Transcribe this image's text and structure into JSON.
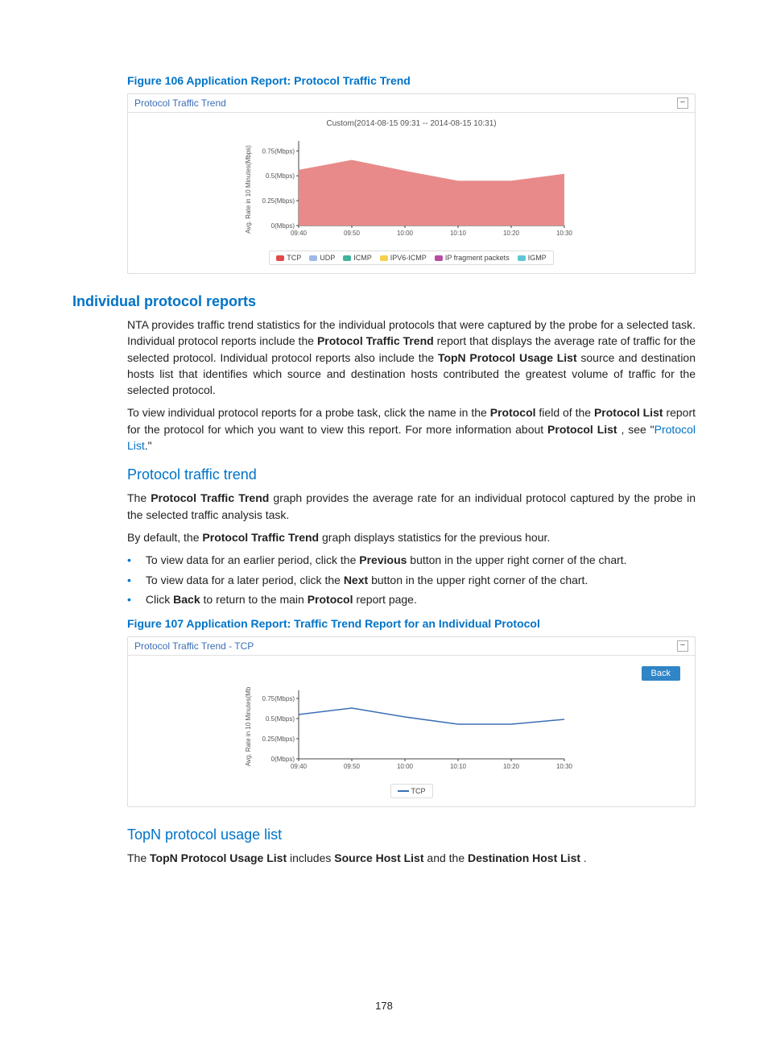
{
  "figure106": {
    "caption": "Figure 106 Application Report: Protocol Traffic Trend",
    "panel_title": "Protocol Traffic Trend",
    "collapse_glyph": "−",
    "chart_caption": "Custom(2014-08-15 09:31 -- 2014-08-15 10:31)",
    "legend": {
      "tcp": {
        "label": "TCP",
        "color": "#e24a4a"
      },
      "udp": {
        "label": "UDP",
        "color": "#9fb8e8"
      },
      "icmp": {
        "label": "ICMP",
        "color": "#3fb39c"
      },
      "ipv6": {
        "label": "IPV6-ICMP",
        "color": "#f3d24b"
      },
      "frag": {
        "label": "IP fragment packets",
        "color": "#b64da0"
      },
      "igmp": {
        "label": "IGMP",
        "color": "#5fc6d6"
      }
    }
  },
  "chart_data": [
    {
      "type": "area",
      "title": "Custom(2014-08-15 09:31 -- 2014-08-15 10:31)",
      "xlabel": "",
      "ylabel": "Avg. Rate in 10 Minutes(Mbps)",
      "categories": [
        "09:40",
        "09:50",
        "10:00",
        "10:10",
        "10:20",
        "10:30"
      ],
      "ylim": [
        0,
        0.85
      ],
      "yticks": [
        "0(Mbps)",
        "0.25(Mbps)",
        "0.5(Mbps)",
        "0.75(Mbps)"
      ],
      "series": [
        {
          "name": "TCP",
          "color": "#e88a8a",
          "values": [
            0.56,
            0.66,
            0.55,
            0.45,
            0.45,
            0.52
          ]
        },
        {
          "name": "UDP",
          "color": "#9fb8e8",
          "values": [
            0,
            0,
            0,
            0,
            0,
            0
          ]
        },
        {
          "name": "ICMP",
          "color": "#3fb39c",
          "values": [
            0,
            0,
            0,
            0,
            0,
            0
          ]
        },
        {
          "name": "IPV6-ICMP",
          "color": "#f3d24b",
          "values": [
            0,
            0,
            0,
            0,
            0,
            0
          ]
        },
        {
          "name": "IP fragment packets",
          "color": "#b64da0",
          "values": [
            0,
            0,
            0,
            0,
            0,
            0
          ]
        },
        {
          "name": "IGMP",
          "color": "#5fc6d6",
          "values": [
            0,
            0,
            0,
            0,
            0,
            0
          ]
        }
      ]
    },
    {
      "type": "line",
      "title": "",
      "xlabel": "",
      "ylabel": "Avg. Rate in 10 Minutes(Mb",
      "categories": [
        "09:40",
        "09:50",
        "10:00",
        "10:10",
        "10:20",
        "10:30"
      ],
      "ylim": [
        0,
        0.85
      ],
      "yticks": [
        "0(Mbps)",
        "0.25(Mbps)",
        "0.5(Mbps)",
        "0.75(Mbps)"
      ],
      "series": [
        {
          "name": "TCP",
          "color": "#3b6fb6",
          "values": [
            0.55,
            0.63,
            0.52,
            0.43,
            0.43,
            0.49
          ]
        }
      ]
    }
  ],
  "section_individual": {
    "heading": "Individual protocol reports",
    "p1_a": "NTA provides traffic trend statistics for the individual protocols that were captured by the probe for a selected task. Individual protocol reports include the ",
    "p1_b": "Protocol Traffic Trend",
    "p1_c": " report that displays the average rate of traffic for the selected protocol. Individual protocol reports also include the ",
    "p1_d": "TopN Protocol Usage List",
    "p1_e": " source and destination hosts list that identifies which source and destination hosts contributed the greatest volume of traffic for the selected protocol.",
    "p2_a": "To view individual protocol reports for a probe task, click the name in the ",
    "p2_b": "Protocol",
    "p2_c": " field of the ",
    "p2_d": "Protocol List",
    "p2_e": " report for the protocol for which you want to view this report. For more information about ",
    "p2_f": "Protocol List",
    "p2_g": ", see \"",
    "p2_link_text": "Protocol List",
    "p2_h": ".\""
  },
  "section_trend": {
    "heading": "Protocol traffic trend",
    "p1_a": "The ",
    "p1_b": "Protocol Traffic Trend",
    "p1_c": " graph provides the average rate for an individual protocol captured by the probe in the selected traffic analysis task.",
    "p2_a": "By default, the ",
    "p2_b": "Protocol Traffic Trend",
    "p2_c": " graph displays statistics for the previous hour.",
    "b1_a": "To view data for an earlier period, click the ",
    "b1_b": "Previous",
    "b1_c": " button in the upper right corner of the chart.",
    "b2_a": "To view data for a later period, click the ",
    "b2_b": "Next",
    "b2_c": " button in the upper right corner of the chart.",
    "b3_a": "Click ",
    "b3_b": "Back",
    "b3_c": " to return to the main ",
    "b3_d": "Protocol",
    "b3_e": " report page."
  },
  "figure107": {
    "caption": "Figure 107 Application Report: Traffic Trend Report for an Individual Protocol",
    "panel_title": "Protocol Traffic Trend - TCP",
    "collapse_glyph": "−",
    "back_label": "Back",
    "legend_tcp": "TCP"
  },
  "section_topn": {
    "heading": "TopN protocol usage list",
    "p1_a": "The ",
    "p1_b": "TopN Protocol Usage List",
    "p1_c": " includes ",
    "p1_d": "Source Host List",
    "p1_e": " and the ",
    "p1_f": "Destination Host List",
    "p1_g": "."
  },
  "page_number": "178"
}
